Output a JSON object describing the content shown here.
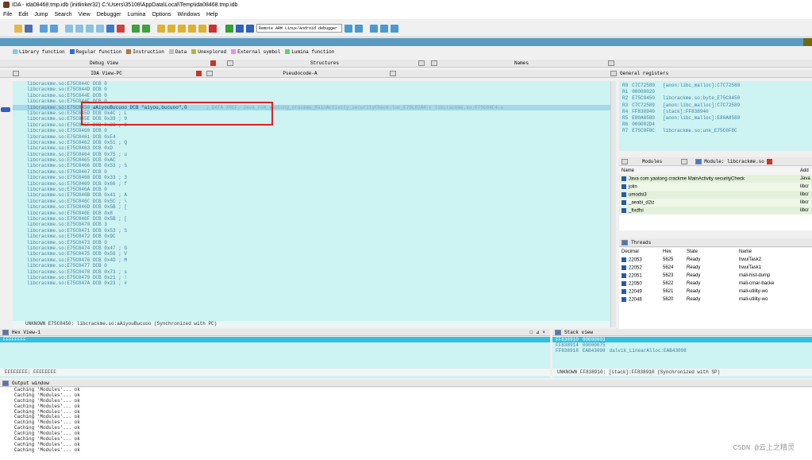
{
  "window": {
    "title": "IDA - ida08468.tmp.idb (initlinker32) C:\\Users\\35108\\AppData\\Local\\Temp\\ida08468.tmp.idb"
  },
  "menu": [
    "File",
    "Edit",
    "Jump",
    "Search",
    "View",
    "Debugger",
    "Lumina",
    "Options",
    "Windows",
    "Help"
  ],
  "toolbar": {
    "debugger_select": "Remote ARM Linux/Android debugger"
  },
  "legend": [
    {
      "label": "Library function",
      "color": "#7ec8ff"
    },
    {
      "label": "Regular function",
      "color": "#2f6ad8"
    },
    {
      "label": "Instruction",
      "color": "#b5733a"
    },
    {
      "label": "Data",
      "color": "#c0c0c0"
    },
    {
      "label": "Unexplored",
      "color": "#b5b53a"
    },
    {
      "label": "External symbol",
      "color": "#f08cf0"
    },
    {
      "label": "Lumina function",
      "color": "#5bd46a"
    }
  ],
  "tabs_top": {
    "debug_view": "Debug View",
    "structures": "Structures",
    "names": "Names"
  },
  "tabs_second": {
    "ida_view": "IDA View-PC",
    "pseudocode": "Pseudocode-A",
    "general_registers": "General registers"
  },
  "listing": [
    {
      "addr": "libcrackme.so:E75C844C",
      "text": "DCB    0",
      "hl": false
    },
    {
      "addr": "libcrackme.so:E75C844D",
      "text": "DCB    0",
      "hl": false
    },
    {
      "addr": "libcrackme.so:E75C844E",
      "text": "DCB    0",
      "hl": false
    },
    {
      "addr": "libcrackme.so:E75C844F",
      "text": "DCB    0",
      "hl": false
    },
    {
      "addr": "libcrackme.so:E75C8450",
      "text": "aAiyouBucuoo DCB \"aiyou,bucuoo\",0",
      "hl": true,
      "xref": "; DATA XREF: Java_com_yaotong_crackme_MainActivity_securityCheck:loc_E75C82A8↑r libcrackme.so:E75C84C4↓o"
    },
    {
      "addr": "libcrackme.so:E75C845D",
      "text": "DCB 0x4C ; L",
      "hl": false
    },
    {
      "addr": "libcrackme.so:E75C845E",
      "text": "DCB 0x39 ; 9",
      "hl": false
    },
    {
      "addr": "libcrackme.so:E75C845F",
      "text": "DCB 0x39 ; 9",
      "hl": false
    },
    {
      "addr": "libcrackme.so:E75C8460",
      "text": "DCB    0",
      "hl": false
    },
    {
      "addr": "libcrackme.so:E75C8461",
      "text": "DCB 0xF4",
      "hl": false
    },
    {
      "addr": "libcrackme.so:E75C8462",
      "text": "DCB 0x51 ; Q",
      "hl": false
    },
    {
      "addr": "libcrackme.so:E75C8463",
      "text": "DCB  0xD",
      "hl": false
    },
    {
      "addr": "libcrackme.so:E75C8464",
      "text": "DCB 0x75 ; u",
      "hl": false
    },
    {
      "addr": "libcrackme.so:E75C8465",
      "text": "DCB 0xAC",
      "hl": false
    },
    {
      "addr": "libcrackme.so:E75C8466",
      "text": "DCB 0x53 ; S",
      "hl": false
    },
    {
      "addr": "libcrackme.so:E75C8467",
      "text": "DCB    0",
      "hl": false
    },
    {
      "addr": "libcrackme.so:E75C8468",
      "text": "DCB 0x33 ; 3",
      "hl": false
    },
    {
      "addr": "libcrackme.so:E75C8469",
      "text": "DCB 0x66 ; f",
      "hl": false
    },
    {
      "addr": "libcrackme.so:E75C846A",
      "text": "DCB    0",
      "hl": false
    },
    {
      "addr": "libcrackme.so:E75C846B",
      "text": "DCB 0x41 ; A",
      "hl": false
    },
    {
      "addr": "libcrackme.so:E75C846C",
      "text": "DCB 0x5C ; \\",
      "hl": false
    },
    {
      "addr": "libcrackme.so:E75C846D",
      "text": "DCB 0x5B ; [",
      "hl": false
    },
    {
      "addr": "libcrackme.so:E75C846E",
      "text": "DCB  0x8",
      "hl": false
    },
    {
      "addr": "libcrackme.so:E75C846F",
      "text": "DCB 0x5B ; [",
      "hl": false
    },
    {
      "addr": "libcrackme.so:E75C8470",
      "text": "DCB    3",
      "hl": false
    },
    {
      "addr": "libcrackme.so:E75C8471",
      "text": "DCB 0x53 ; S",
      "hl": false
    },
    {
      "addr": "libcrackme.so:E75C8472",
      "text": "DCB 0x9C",
      "hl": false
    },
    {
      "addr": "libcrackme.so:E75C8473",
      "text": "DCB    0",
      "hl": false
    },
    {
      "addr": "libcrackme.so:E75C8474",
      "text": "DCB 0x47 ; G",
      "hl": false
    },
    {
      "addr": "libcrackme.so:E75C8475",
      "text": "DCB 0x56 ; V",
      "hl": false
    },
    {
      "addr": "libcrackme.so:E75C8476",
      "text": "DCB 0x4D ; M",
      "hl": false
    },
    {
      "addr": "libcrackme.so:E75C8477",
      "text": "DCB    0",
      "hl": false
    },
    {
      "addr": "libcrackme.so:E75C8478",
      "text": "DCB 0x73 ; s",
      "hl": false
    },
    {
      "addr": "libcrackme.so:E75C8479",
      "text": "DCB 0x21 ; !",
      "hl": false
    },
    {
      "addr": "libcrackme.so:E75C847A",
      "text": "DCB 0x23 ; #",
      "hl": false
    }
  ],
  "listing_status": "UNKNOWN E75C8450: libcrackme.so:aAiyouBucuoo (Synchronized with PC)",
  "registers": [
    {
      "name": "R0",
      "value": "C7C72580",
      "ref": "[anon:libc_malloc]:C7C72580"
    },
    {
      "name": "R1",
      "value": "00000020",
      "ref": ""
    },
    {
      "name": "R2",
      "value": "E75C8450",
      "ref": "libcrackme.so:byte_E75C8450"
    },
    {
      "name": "R3",
      "value": "C7C72589",
      "ref": "[anon:libc_malloc]:C7C72589"
    },
    {
      "name": "R4",
      "value": "FF838940",
      "ref": "[stack]:FF838940"
    },
    {
      "name": "R5",
      "value": "E80A8580",
      "ref": "[anon:libc_malloc]:E80A8580"
    },
    {
      "name": "R6",
      "value": "000002D4",
      "ref": ""
    },
    {
      "name": "R7",
      "value": "E75C0F8C",
      "ref": "libcrackme.so:unk_E75C0F8C"
    }
  ],
  "modules_tabs": {
    "modules": "Modules",
    "module_lib": "Module: libcrackme.so"
  },
  "modules_header": {
    "name": "Name",
    "address": "Add"
  },
  "modules_rows": [
    {
      "name": "Java com yaotong crackme MainActivity securityCheck",
      "addr": "Java"
    },
    {
      "name": "jolin",
      "addr": "libcr"
    },
    {
      "name": "umodsi3",
      "addr": "libcr"
    },
    {
      "name": "_aeabi_d2iz",
      "addr": "libcr"
    },
    {
      "name": "_fixdfsi",
      "addr": "libcr"
    }
  ],
  "threads_tab": "Threads",
  "threads_header": {
    "decimal": "Decimal",
    "hex": "Hex",
    "state": "State",
    "name": "Name"
  },
  "threads": [
    {
      "dec": "22053",
      "hex": "5625",
      "state": "Ready",
      "name": "hwuiTask2"
    },
    {
      "dec": "22052",
      "hex": "5624",
      "state": "Ready",
      "name": "hwuiTask1"
    },
    {
      "dec": "22051",
      "hex": "5623",
      "state": "Ready",
      "name": "mali-hist-dump"
    },
    {
      "dec": "22050",
      "hex": "5622",
      "state": "Ready",
      "name": "mali-cmar-backe"
    },
    {
      "dec": "22049",
      "hex": "5621",
      "state": "Ready",
      "name": "mali-utility-wo"
    },
    {
      "dec": "22048",
      "hex": "5620",
      "state": "Ready",
      "name": "mali-utility-wo"
    }
  ],
  "hex_view": {
    "title": "Hex View-1",
    "line1": "FFFFFFFF",
    "status": "FFFFFFFF: FFFFFFFF"
  },
  "stack_view": {
    "title": "Stack view",
    "rows": [
      {
        "addr": "FF838910",
        "val": "00000003",
        "ref": ""
      },
      {
        "addr": "FF838914",
        "val": "00000075",
        "ref": ""
      },
      {
        "addr": "FF838918",
        "val": "EAB43098",
        "ref": "dalvik_LinearAlloc:EAB43098"
      }
    ],
    "status": "UNKNOWN FF838910: [stack]:FF838910 (Synchronized with SP)"
  },
  "output": {
    "title": "Output window",
    "lines": [
      "Caching 'Modules'... ok",
      "Caching 'Modules'... ok",
      "Caching 'Modules'... ok",
      "Caching 'Modules'... ok",
      "Caching 'Modules'... ok",
      "Caching 'Modules'... ok",
      "Caching 'Modules'... ok",
      "Caching 'Modules'... ok",
      "Caching 'Modules'... ok",
      "Caching 'Modules'... ok",
      "Caching 'Modules'... ok",
      "Caching 'Modules'... ok"
    ]
  },
  "watermark": "CSDN @云上之精灵"
}
